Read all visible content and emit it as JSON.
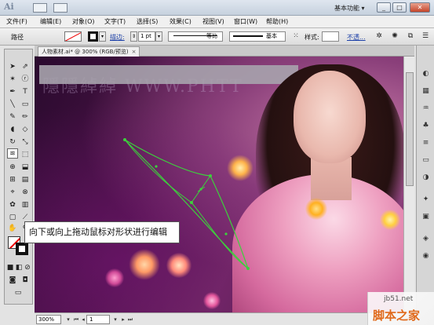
{
  "titlebar": {
    "logo": "Ai",
    "workspace_label": "基本功能 ▾",
    "min_symbol": "_",
    "max_symbol": "□",
    "close_symbol": "✕"
  },
  "menu": {
    "items": [
      "文件(F)",
      "编辑(E)",
      "对象(O)",
      "文字(T)",
      "选择(S)",
      "效果(C)",
      "视图(V)",
      "窗口(W)",
      "帮助(H)"
    ]
  },
  "control_bar": {
    "object_label": "路径",
    "stroke_label": "描边:",
    "stroke_weight": "1 pt",
    "profile_label": "等比",
    "brush_label": "基本",
    "style_label": "样式:",
    "opacity_label": "不透..."
  },
  "document": {
    "tab_label": "人物素材.ai* @ 300% (RGB/预览)",
    "tab_close": "×"
  },
  "canvas": {
    "banner_text": "隱隱綽綽  WWW.PHTT"
  },
  "tooltip": {
    "text": "向下或向上拖动鼠标对形状进行编辑"
  },
  "status": {
    "zoom": "300%",
    "page": "1"
  },
  "watermark": {
    "site": "jb51.net",
    "text": "脚本之家"
  },
  "colors": {
    "path_stroke": "#3cd13c",
    "tooltip_bg": "#ffffff",
    "accent_watermark": "#e06a1c"
  }
}
